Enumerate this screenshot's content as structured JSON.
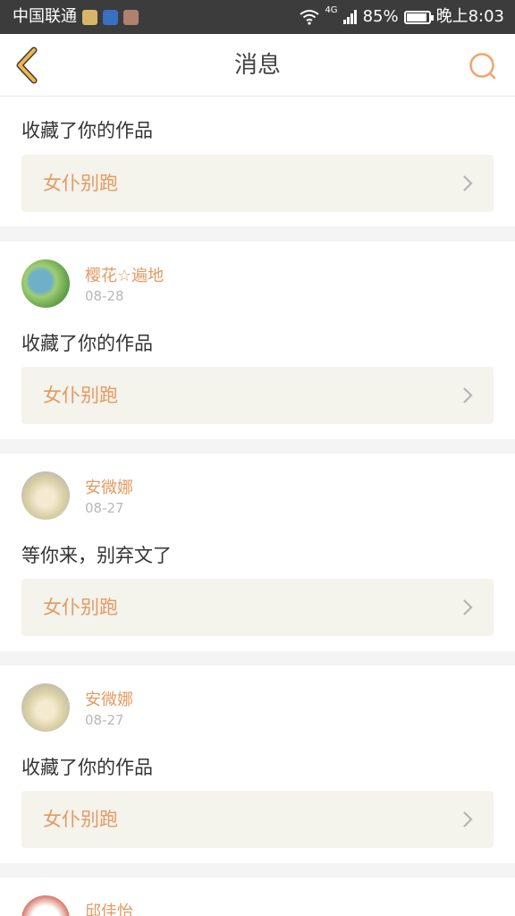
{
  "status_bar": {
    "carrier": "中国联通",
    "network": "4G",
    "battery": "85%",
    "battery_level": 0.85,
    "time": "晚上8:03"
  },
  "header": {
    "title": "消息",
    "back_icon": "chevron-left-icon",
    "search_icon": "search-icon"
  },
  "colors": {
    "accent": "#e39a62",
    "back_icon": "#f0b64a",
    "search_icon": "#f2a36b",
    "link_bg": "#f4f3ec",
    "statusbar_bg": "#3c3c3c"
  },
  "messages": [
    {
      "user": "",
      "date": "",
      "text": "收藏了你的作品",
      "work": "女仆别跑"
    },
    {
      "user": "樱花☆遍地",
      "date": "08-28",
      "text": "收藏了你的作品",
      "work": "女仆别跑"
    },
    {
      "user": "安微娜",
      "date": "08-27",
      "text": "等你来，别弃文了",
      "work": "女仆别跑"
    },
    {
      "user": "安微娜",
      "date": "08-27",
      "text": "收藏了你的作品",
      "work": "女仆别跑"
    },
    {
      "user": "邱佳怡",
      "date": "",
      "text": "",
      "work": ""
    }
  ]
}
